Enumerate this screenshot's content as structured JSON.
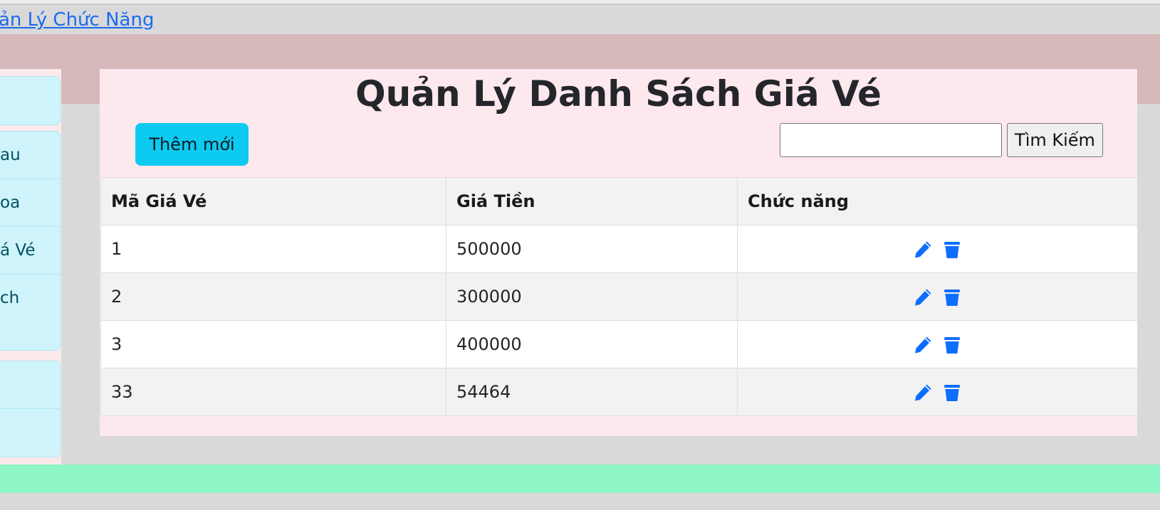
{
  "nav": {
    "breadcrumb_link": "ản Lý Chức Năng"
  },
  "sidebar": {
    "groups": [
      {
        "items": [
          {
            "label": ""
          }
        ]
      },
      {
        "items": [
          {
            "label": "au"
          },
          {
            "label": "oa"
          },
          {
            "label": "á Vé"
          },
          {
            "label": "ch"
          }
        ]
      },
      {
        "items": [
          {
            "label": ""
          },
          {
            "label": ""
          }
        ]
      }
    ]
  },
  "main": {
    "title": "Quản Lý Danh Sách Giá Vé",
    "add_button_label": "Thêm mới",
    "search": {
      "value": "",
      "placeholder": "",
      "button_label": "Tìm Kiếm"
    },
    "table": {
      "columns": [
        "Mã Giá Vé",
        "Giá Tiền",
        "Chức năng"
      ],
      "rows": [
        {
          "id": "1",
          "price": "500000"
        },
        {
          "id": "2",
          "price": "300000"
        },
        {
          "id": "3",
          "price": "400000"
        },
        {
          "id": "33",
          "price": "54464"
        }
      ],
      "row_actions": [
        {
          "icon": "pencil-icon",
          "color": "#0d6efd"
        },
        {
          "icon": "trash-icon",
          "color": "#0d6efd"
        }
      ]
    }
  },
  "colors": {
    "accent": "#0dcaf0",
    "link": "#1a6bf0",
    "icon": "#0d6efd",
    "header_band": "#d5b8b9",
    "card_background": "#fde8ee",
    "sidebar_item": "#cff4fc",
    "footer_band": "#8ef5c6"
  }
}
